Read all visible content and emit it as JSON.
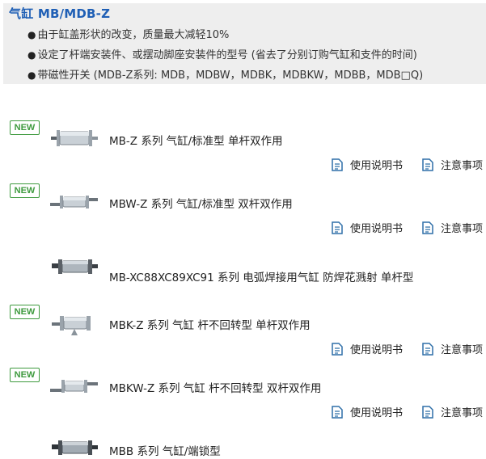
{
  "header": {
    "title": "气缸 MB/MDB-Z",
    "features": [
      "由于缸盖形状的改变，质量最大减轻10%",
      "设定了杆端安装件、或摆动脚座安装件的型号 (省去了分别订购气缸和支件的时间)",
      "带磁性开关 (MDB-Z系列: MDB，MDBW，MDBK，MDBKW，MDBB，MDB□Q)"
    ]
  },
  "labels": {
    "new_badge": "NEW",
    "manual_link": "使用说明书",
    "caution_link": "注意事项"
  },
  "products": [
    {
      "name": "MB-Z 系列 气缸/标准型 单杆双作用",
      "is_new": true,
      "has_docs": true,
      "image": "double-acting-cylinder"
    },
    {
      "name": "MBW-Z 系列 气缸/标准型 双杆双作用",
      "is_new": true,
      "has_docs": true,
      "image": "double-rod-cylinder"
    },
    {
      "name": "MB-XC88XC89XC91 系列 电弧焊接用气缸 防焊花溅射 单杆型",
      "is_new": false,
      "has_docs": false,
      "image": "welding-cylinder"
    },
    {
      "name": "MBK-Z 系列 气缸 杆不回转型 单杆双作用",
      "is_new": true,
      "has_docs": true,
      "image": "non-rotating-cylinder"
    },
    {
      "name": "MBKW-Z 系列 气缸 杆不回转型 双杆双作用",
      "is_new": true,
      "has_docs": true,
      "image": "non-rotating-double-rod-cylinder"
    },
    {
      "name": "MBB 系列 气缸/端锁型",
      "is_new": false,
      "has_docs": false,
      "image": "end-lock-cylinder"
    }
  ],
  "colors": {
    "title": "#1f5fb5",
    "new_badge": "#3e9a3e",
    "doc_icon": "#2f6fa8",
    "header_bg": "#eeeeee"
  }
}
